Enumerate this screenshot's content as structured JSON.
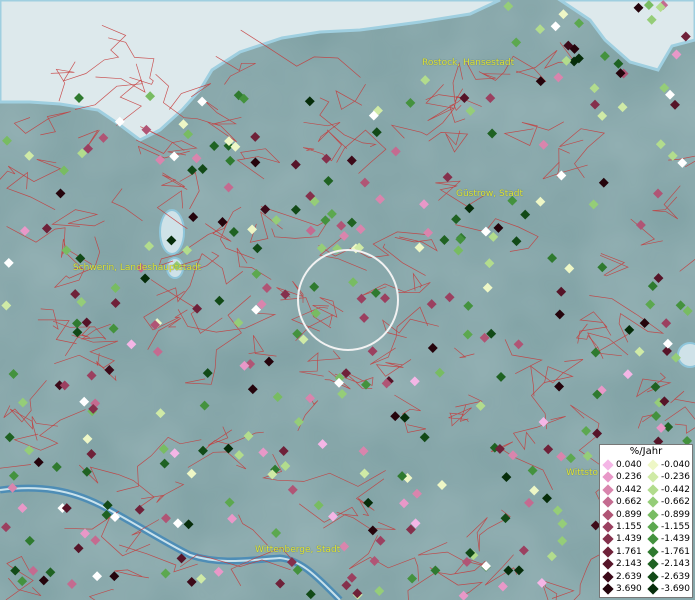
{
  "map": {
    "places": [
      {
        "label": "Rostock, Hansestadt"
      },
      {
        "label": "Güstrow, Stadt"
      },
      {
        "label": "Schwerin, Landeshauptstadt"
      },
      {
        "label": "Wittenberge, Stadt"
      },
      {
        "label": "Wittsto"
      }
    ]
  },
  "legend": {
    "title": "%/Jahr",
    "positive": [
      {
        "label": "0.040",
        "color": "#f4b6e6"
      },
      {
        "label": "0.236",
        "color": "#e898c8"
      },
      {
        "label": "0.442",
        "color": "#d985ad"
      },
      {
        "label": "0.662",
        "color": "#c46b90"
      },
      {
        "label": "0.899",
        "color": "#b05575"
      },
      {
        "label": "1.155",
        "color": "#9b4060"
      },
      {
        "label": "1.439",
        "color": "#85304c"
      },
      {
        "label": "1.761",
        "color": "#6f2139"
      },
      {
        "label": "2.143",
        "color": "#561428"
      },
      {
        "label": "2.639",
        "color": "#3d0a19"
      },
      {
        "label": "3.690",
        "color": "#25040c"
      }
    ],
    "negative": [
      {
        "label": "-0.040",
        "color": "#eef7c6"
      },
      {
        "label": "-0.236",
        "color": "#cfeaa6"
      },
      {
        "label": "-0.442",
        "color": "#b2dc8d"
      },
      {
        "label": "-0.662",
        "color": "#95cd78"
      },
      {
        "label": "-0.899",
        "color": "#78bc62"
      },
      {
        "label": "-1.155",
        "color": "#5ca84f"
      },
      {
        "label": "-1.439",
        "color": "#44923e"
      },
      {
        "label": "-1.761",
        "color": "#2f7a2f"
      },
      {
        "label": "-2.143",
        "color": "#1f6222"
      },
      {
        "label": "-2.639",
        "color": "#124a17"
      },
      {
        "label": "-3.690",
        "color": "#062d0a"
      }
    ]
  }
}
